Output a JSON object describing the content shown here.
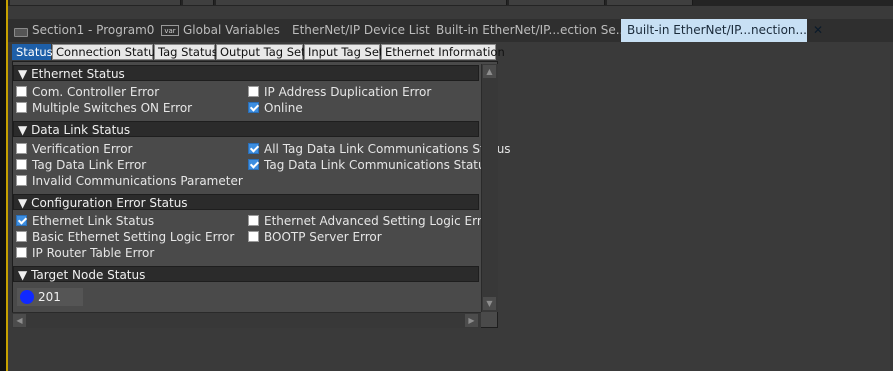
{
  "window": {
    "doc_tabs": [
      {
        "label": "Section1 - Program0",
        "icon": "program-icon"
      },
      {
        "label": "Global Variables",
        "icon": "variable-table-icon"
      },
      {
        "label": "EtherNet/IP Device List"
      },
      {
        "label": "Built-in EtherNet/IP...ection Se..."
      },
      {
        "label": "Built-in EtherNet/IP...nection...",
        "active": true,
        "close_glyph": "✕"
      }
    ]
  },
  "subtabs": [
    {
      "label": "Status",
      "active": true
    },
    {
      "label": "Connection Status"
    },
    {
      "label": "Tag Status"
    },
    {
      "label": "Output Tag Set"
    },
    {
      "label": "Input Tag Set"
    },
    {
      "label": "Ethernet Information"
    }
  ],
  "sections": {
    "ethernet_status": {
      "header": "Ethernet Status",
      "items": [
        {
          "label": "Com. Controller Error",
          "checked": false
        },
        {
          "label": "IP Address Duplication Error",
          "checked": false
        },
        {
          "label": "Multiple Switches ON Error",
          "checked": false
        },
        {
          "label": "Online",
          "checked": true
        }
      ]
    },
    "data_link_status": {
      "header": "Data Link Status",
      "items": [
        {
          "label": "Verification Error",
          "checked": false
        },
        {
          "label": "All Tag Data Link Communications Status",
          "checked": true
        },
        {
          "label": "Tag Data Link Error",
          "checked": false
        },
        {
          "label": "Tag Data Link Communications Status",
          "checked": true
        },
        {
          "label": "Invalid Communications Parameter",
          "checked": false
        }
      ]
    },
    "configuration_error_status": {
      "header": "Configuration Error Status",
      "items": [
        {
          "label": "Ethernet Link Status",
          "checked": true
        },
        {
          "label": "Ethernet Advanced Setting Logic Error",
          "checked": false
        },
        {
          "label": "Basic Ethernet Setting Logic Error",
          "checked": false
        },
        {
          "label": "BOOTP Server Error",
          "checked": false
        },
        {
          "label": "IP Router Table Error",
          "checked": false
        }
      ]
    },
    "target_node_status": {
      "header": "Target Node Status",
      "nodes": [
        {
          "label": "201",
          "color": "#1029ff"
        }
      ]
    }
  },
  "glyphs": {
    "expand": "▼",
    "scroll_up": "▲",
    "scroll_down": "▼",
    "scroll_left": "◀",
    "scroll_right": "▶"
  }
}
